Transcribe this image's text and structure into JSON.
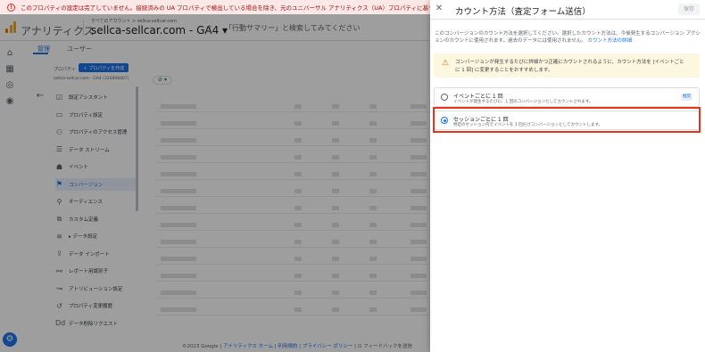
{
  "banner": {
    "text": "このプロパティの設定は完了していません。接続済みの UA プロパティで検出している場合を除き、元のユニバーサル アナリティクス（UA）プロパティに基づいて設定が"
  },
  "header": {
    "app_title": "アナリティクス",
    "account_path": "すべてのアカウント > sellca-sellcar.com",
    "property_name": "sellca-sellcar.com - GA4 ▾",
    "search_placeholder": "「行動サマリー」と検索してみてください"
  },
  "tabs": [
    "管理",
    "ユーザー"
  ],
  "admin": {
    "property_label": "プロパティ",
    "create_property": "＋ プロパティを作成",
    "property_id": "sellca-sellcar.com - GA4 (326808407)",
    "menu": [
      {
        "label": "設定アシスタント",
        "icon": "checklist-icon"
      },
      {
        "label": "プロパティ設定",
        "icon": "property-icon"
      },
      {
        "label": "プロパティのアクセス管理",
        "icon": "people-icon"
      },
      {
        "label": "データ ストリーム",
        "icon": "stream-icon"
      },
      {
        "label": "イベント",
        "icon": "event-icon"
      },
      {
        "label": "コンバージョン",
        "icon": "flag-icon"
      },
      {
        "label": "オーディエンス",
        "icon": "audience-icon"
      },
      {
        "label": "カスタム定義",
        "icon": "custom-def-icon"
      },
      {
        "label": "▸ データ設定",
        "icon": "data-settings-icon"
      },
      {
        "label": "データ インポート",
        "icon": "upload-icon"
      },
      {
        "label": "レポート用識別子",
        "icon": "identity-icon"
      },
      {
        "label": "アトリビューション設定",
        "icon": "attribution-icon"
      },
      {
        "label": "プロパティ変更履歴",
        "icon": "history-icon"
      },
      {
        "label": "データ削除リクエスト",
        "icon": "delete-data-icon"
      }
    ]
  },
  "footer": {
    "copyright": "©2023 Google | ",
    "link1": "アナリティクス ホーム",
    "sep1": " | ",
    "link2": "利用規約",
    "sep2": " | ",
    "link3": "プライバシー ポリシー",
    "sep3": " | ",
    "feedback": "フィードバックを送信"
  },
  "panel": {
    "title": "カウント方法（査定フォーム送信）",
    "save_label": "保存",
    "description": "このコンバージョンのカウント方法を選択してください。選択したカウント方法は、今後発生するコンバージョン アクションのカウントに使用されます。過去のデータには使用されません。",
    "description_link": "カウント方法の詳細",
    "warning": "コンバージョンが発生するたびに詳細かつ正確にカウントされるように、カウント方法を [イベントごとに 1 回] に変更することをおすすめします。",
    "options": [
      {
        "title": "イベントごとに 1 回",
        "subtitle": "イベントが発生するたびに、1 回のコンバージョンとしてカウントされます。",
        "badge": "推奨",
        "checked": false
      },
      {
        "title": "セッションごとに 1 回",
        "subtitle": "特定のセッション内でイベントを 1 回だけコンバージョンとしてカウントします。",
        "checked": true
      }
    ]
  },
  "colors": {
    "accent": "#1a73e8",
    "highlight": "#e8341c",
    "warning_bg": "#fef7e0"
  }
}
